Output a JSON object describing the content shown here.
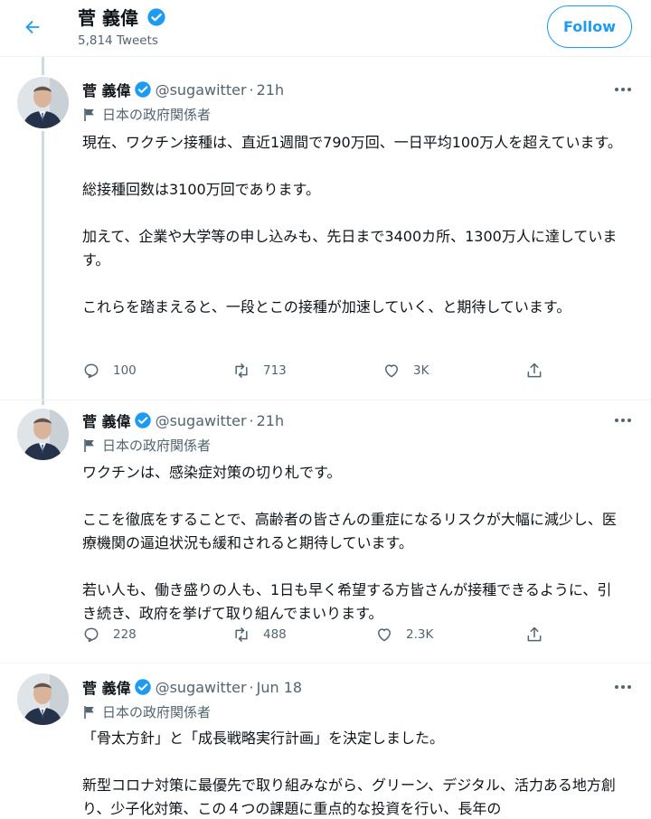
{
  "header": {
    "title": "菅 義偉",
    "tweet_count": "5,814 Tweets",
    "follow_label": "Follow"
  },
  "tweets": [
    {
      "name": "菅 義偉",
      "handle": "@sugawitter",
      "time": "21h",
      "label": "日本の政府関係者",
      "paragraphs": [
        "現在、ワクチン接種は、直近1週間で790万回、一日平均100万人を超えています。",
        "総接種回数は3100万回であります。",
        "加えて、企業や大学等の申し込みも、先日まで3400カ所、1300万人に達しています。",
        "これらを踏まえると、一段とこの接種が加速していく、と期待しています。"
      ],
      "replies": "100",
      "retweets": "713",
      "likes": "3K"
    },
    {
      "name": "菅 義偉",
      "handle": "@sugawitter",
      "time": "21h",
      "label": "日本の政府関係者",
      "paragraphs": [
        "ワクチンは、感染症対策の切り札です。",
        "ここを徹底をすることで、高齢者の皆さんの重症になるリスクが大幅に減少し、医療機関の逼迫状況も緩和されると期待しています。",
        "若い人も、働き盛りの人も、1日も早く希望する方皆さんが接種できるように、引き続き、政府を挙げて取り組んでまいります。"
      ],
      "replies": "228",
      "retweets": "488",
      "likes": "2.3K"
    },
    {
      "name": "菅 義偉",
      "handle": "@sugawitter",
      "time": "Jun 18",
      "label": "日本の政府関係者",
      "paragraphs": [
        "「骨太方針」と「成長戦略実行計画」を決定しました。",
        "新型コロナ対策に最優先で取り組みながら、グリーン、デジタル、活力ある地方創り、少子化対策、この４つの課題に重点的な投資を行い、長年の"
      ]
    }
  ],
  "colors": {
    "accent": "#1d9bf0",
    "secondary_text": "#536471",
    "thread_line": "#cfd9de"
  }
}
